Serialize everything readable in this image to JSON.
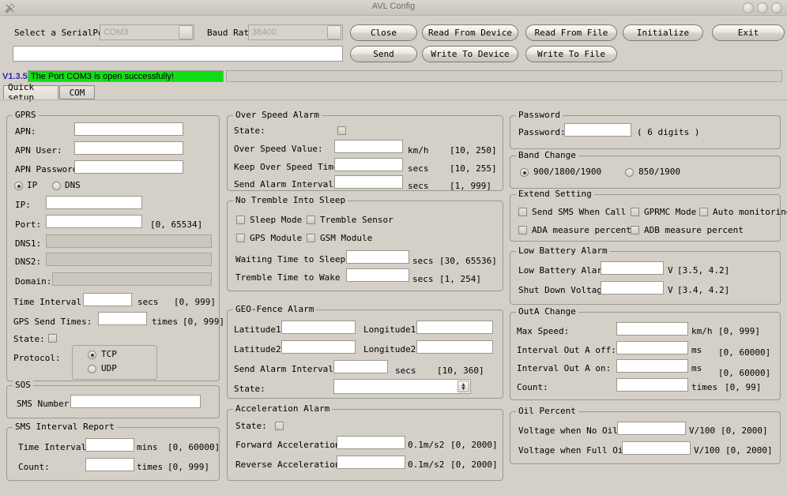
{
  "window": {
    "title": "AVL Config",
    "icon": "tools-icon",
    "controls": [
      "minimize-button",
      "maximize-button",
      "close-button"
    ]
  },
  "toolbar": {
    "serialport_label": "Select a SerialPort",
    "serialport_value": "COM3",
    "baudrate_label": "Baud Rate",
    "baudrate_value": "38400",
    "command_input_value": "",
    "buttons": [
      {
        "name": "close-button",
        "label": "Close"
      },
      {
        "name": "send-button",
        "label": "Send"
      },
      {
        "name": "read-from-device-button",
        "label": "Read  From  Device"
      },
      {
        "name": "write-to-device-button",
        "label": "Write To Device"
      },
      {
        "name": "read-from-file-button",
        "label": "Read From File"
      },
      {
        "name": "write-to-file-button",
        "label": "Write To File"
      },
      {
        "name": "initialize-button",
        "label": "Initialize"
      },
      {
        "name": "exit-button",
        "label": "Exit"
      }
    ]
  },
  "status": {
    "version": "V1.3.5",
    "message": "The Port COM3 is open successfully!"
  },
  "tabs": [
    {
      "name": "tab-quick-setup",
      "label": "Quick setup",
      "active": true
    },
    {
      "name": "tab-com",
      "label": "COM",
      "active": false
    }
  ],
  "gprs": {
    "title": "GPRS",
    "apn_label": "APN:",
    "apn_value": "",
    "apn_user_label": "APN User:",
    "apn_user_value": "",
    "apn_password_label": "APN Password:",
    "apn_password_value": "",
    "mode_ip_label": "IP",
    "mode_dns_label": "DNS",
    "mode_selected": "IP",
    "ip_label": "IP:",
    "ip_value": "",
    "port_label": "Port:",
    "port_value": "",
    "port_range": "[0, 65534]",
    "dns1_label": "DNS1:",
    "dns1_value": "",
    "dns2_label": "DNS2:",
    "dns2_value": "",
    "domain_label": "Domain:",
    "domain_value": "",
    "time_interval_label": "Time Interval:",
    "time_interval_value": "",
    "time_interval_unit": "secs",
    "time_interval_range": "[0, 999]",
    "gps_send_times_label": "GPS Send Times:",
    "gps_send_times_value": "",
    "gps_send_times_unit": "times",
    "gps_send_times_range": "[0, 999]",
    "state_label": "State:",
    "state_checked": false,
    "protocol_label": "Protocol:",
    "protocol_tcp_label": "TCP",
    "protocol_udp_label": "UDP",
    "protocol_selected": "TCP"
  },
  "sos": {
    "title": "SOS",
    "sms_number_label": "SMS Number:",
    "sms_number_value": ""
  },
  "sms_interval_report": {
    "title": "SMS Interval Report",
    "time_interval_label": "Time Interval:",
    "time_interval_value": "",
    "time_interval_unit": "mins",
    "time_interval_range": "[0, 60000]",
    "count_label": "Count:",
    "count_value": "",
    "count_unit": "times",
    "count_range": "[0, 999]"
  },
  "over_speed_alarm": {
    "title": "Over Speed Alarm",
    "state_label": "State:",
    "state_checked": false,
    "over_speed_value_label": "Over Speed Value:",
    "over_speed_value": "",
    "over_speed_unit": "km/h",
    "over_speed_range": "[10, 250]",
    "keep_over_speed_time_label": "Keep Over Speed Time:",
    "keep_over_speed_time_value": "",
    "keep_over_speed_time_unit": "secs",
    "keep_over_speed_time_range": "[10, 255]",
    "send_alarm_interval_label": "Send Alarm Interval:",
    "send_alarm_interval_value": "",
    "send_alarm_interval_unit": "secs",
    "send_alarm_interval_range": "[1, 999]"
  },
  "no_tremble_into_sleep": {
    "title": "No Tremble Into Sleep",
    "sleep_mode_label": "Sleep Mode",
    "sleep_mode_checked": false,
    "tremble_sensor_label": "Tremble Sensor",
    "tremble_sensor_checked": false,
    "gps_module_label": "GPS Module",
    "gps_module_checked": false,
    "gsm_module_label": "GSM Module",
    "gsm_module_checked": false,
    "waiting_time_label": "Waiting Time to Sleep:",
    "waiting_time_value": "",
    "waiting_time_unit": "secs",
    "waiting_time_range": "[30, 65536]",
    "tremble_time_label": "Tremble Time to Wake up:",
    "tremble_time_value": "",
    "tremble_time_unit": "secs",
    "tremble_time_range": "[1, 254]"
  },
  "geo_fence_alarm": {
    "title": "GEO-Fence Alarm",
    "latitude1_label": "Latitude1:",
    "latitude1_value": "",
    "longitude1_label": "Longitude1:",
    "longitude1_value": "",
    "latitude2_label": "Latitude2:",
    "latitude2_value": "",
    "longitude2_label": "Longitude2:",
    "longitude2_value": "",
    "send_alarm_interval_label": "Send Alarm Interval:",
    "send_alarm_interval_value": "",
    "send_alarm_interval_unit": "secs",
    "send_alarm_interval_range": "[10, 360]",
    "state_label": "State:",
    "state_value": ""
  },
  "acceleration_alarm": {
    "title": "Acceleration Alarm",
    "state_label": "State:",
    "state_checked": false,
    "forward_label": "Forward Acceleration:",
    "forward_value": "",
    "forward_unit": "0.1m/s2",
    "forward_range": "[0, 2000]",
    "reverse_label": "Reverse Acceleration:",
    "reverse_value": "",
    "reverse_unit": "0.1m/s2",
    "reverse_range": "[0, 2000]"
  },
  "password": {
    "title": "Password",
    "password_label": "Password:",
    "password_value": "",
    "hint": "( 6 digits )"
  },
  "band_change": {
    "title": "Band Change",
    "option1_label": "900/1800/1900",
    "option2_label": "850/1900",
    "selected": "900/1800/1900"
  },
  "extend_setting": {
    "title": "Extend Setting",
    "send_sms_when_call_label": "Send SMS When Call",
    "send_sms_when_call_checked": false,
    "gprmc_mode_label": "GPRMC Mode",
    "gprmc_mode_checked": false,
    "auto_monitoring_label": "Auto monitoring",
    "auto_monitoring_checked": false,
    "ada_measure_percent_label": "ADA measure percent",
    "ada_measure_percent_checked": false,
    "adb_measure_percent_label": "ADB measure percent",
    "adb_measure_percent_checked": false
  },
  "low_battery_alarm": {
    "title": "Low Battery Alarm",
    "low_battery_label": "Low Battery Alarm:",
    "low_battery_value": "",
    "low_battery_unit": "V",
    "low_battery_range": "[3.5, 4.2]",
    "shut_down_label": "Shut Down Voltage:",
    "shut_down_value": "",
    "shut_down_unit": "V",
    "shut_down_range": "[3.4, 4.2]"
  },
  "outa_change": {
    "title": "OutA Change",
    "max_speed_label": "Max Speed:",
    "max_speed_value": "",
    "max_speed_unit": "km/h",
    "max_speed_range": "[0, 999]",
    "interval_off_label": "Interval Out A off:",
    "interval_off_value": "",
    "interval_off_unit": "ms",
    "interval_off_range": "[0, 60000]",
    "interval_on_label": "Interval Out A on:",
    "interval_on_value": "",
    "interval_on_unit": "ms",
    "interval_on_range": "[0, 60000]",
    "count_label": "Count:",
    "count_value": "",
    "count_unit": "times",
    "count_range": "[0, 99]"
  },
  "oil_percent": {
    "title": "Oil Percent",
    "no_oil_label": "Voltage when No Oil:",
    "no_oil_value": "",
    "no_oil_unit": "V/100",
    "no_oil_range": "[0, 2000]",
    "full_oil_label": "Voltage when Full Oil:",
    "full_oil_value": "",
    "full_oil_unit": "V/100",
    "full_oil_range": "[0, 2000]"
  },
  "colors": {
    "background": "#d4d0c8",
    "status_ok": "#11dd16",
    "version_text": "#2a2ab0",
    "field_background": "#ffffff",
    "field_disabled": "#cac7bf"
  }
}
